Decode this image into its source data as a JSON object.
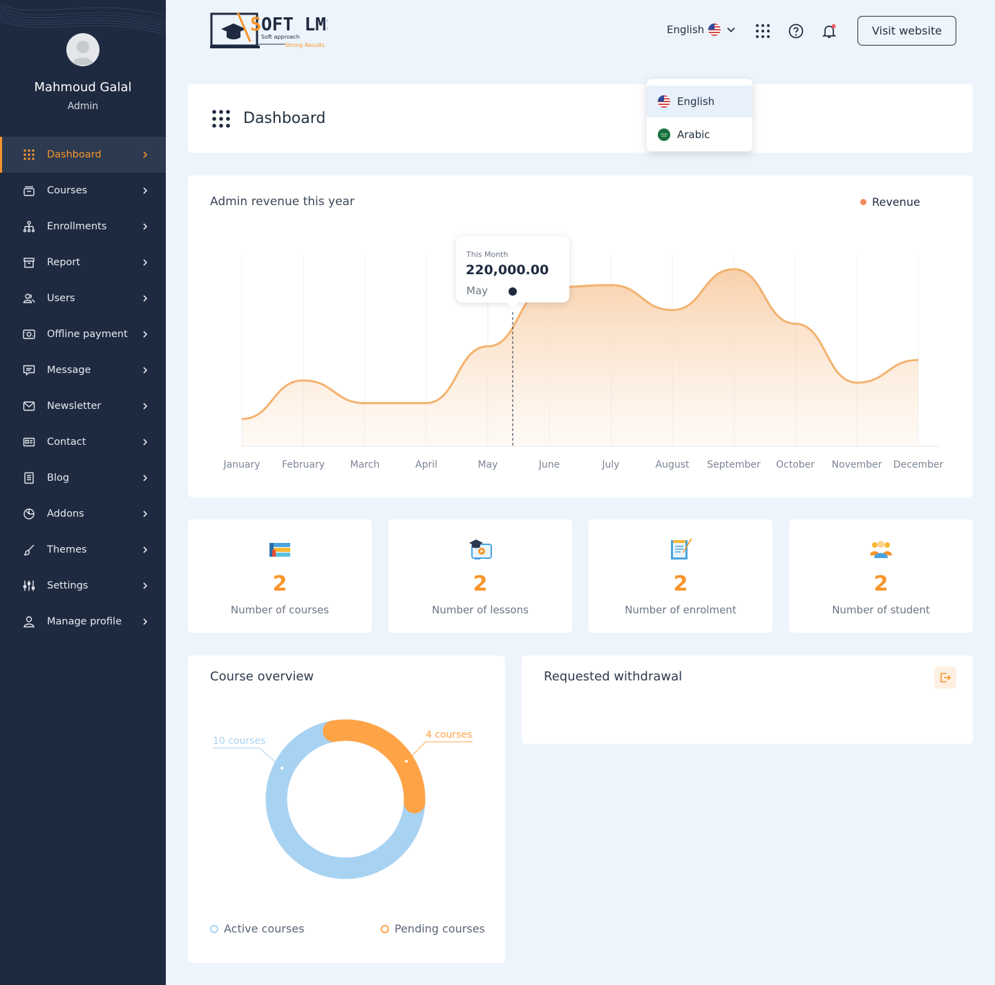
{
  "brand": {
    "name": "SOFT LMS",
    "tagline_1": "Soft approach",
    "tagline_2": "Strong Results"
  },
  "profile": {
    "name": "Mahmoud Galal",
    "role": "Admin"
  },
  "sidebar": {
    "items": [
      {
        "label": "Dashboard",
        "icon": "grid-dots-icon",
        "active": true
      },
      {
        "label": "Courses",
        "icon": "courses-icon"
      },
      {
        "label": "Enrollments",
        "icon": "hierarchy-icon"
      },
      {
        "label": "Report",
        "icon": "archive-icon"
      },
      {
        "label": "Users",
        "icon": "users-icon"
      },
      {
        "label": "Offline payment",
        "icon": "cash-icon"
      },
      {
        "label": "Message",
        "icon": "message-icon"
      },
      {
        "label": "Newsletter",
        "icon": "mail-icon"
      },
      {
        "label": "Contact",
        "icon": "contact-card-icon"
      },
      {
        "label": "Blog",
        "icon": "document-icon"
      },
      {
        "label": "Addons",
        "icon": "addons-icon"
      },
      {
        "label": "Themes",
        "icon": "brush-icon"
      },
      {
        "label": "Settings",
        "icon": "sliders-icon"
      },
      {
        "label": "Manage profile",
        "icon": "user-icon"
      }
    ]
  },
  "header": {
    "language": "English",
    "visit_label": "Visit website",
    "language_menu": [
      "English",
      "Arabic"
    ]
  },
  "page": {
    "title": "Dashboard"
  },
  "revenue": {
    "title": "Admin revenue this year",
    "legend": "Revenue",
    "tooltip": {
      "label": "This Month",
      "value": "220,000.00",
      "month": "May"
    }
  },
  "chart_data": {
    "type": "area",
    "title": "Admin revenue this year",
    "categories": [
      "January",
      "February",
      "March",
      "April",
      "May",
      "June",
      "July",
      "August",
      "September",
      "October",
      "November",
      "December"
    ],
    "series": [
      {
        "name": "Revenue",
        "values": [
          60000,
          145000,
          95000,
          95000,
          220000,
          350000,
          355000,
          300000,
          390000,
          270000,
          140000,
          190000
        ]
      }
    ],
    "legend": "top-right",
    "grid": "vertical"
  },
  "stats": [
    {
      "value": "2",
      "label": "Number of courses",
      "icon": "books-icon"
    },
    {
      "value": "2",
      "label": "Number of lessons",
      "icon": "video-lesson-icon"
    },
    {
      "value": "2",
      "label": "Number of enrolment",
      "icon": "notepad-icon"
    },
    {
      "value": "2",
      "label": "Number of student",
      "icon": "students-icon"
    }
  ],
  "course_overview": {
    "title": "Course overview",
    "active_label": "10 courses",
    "pending_label": "4 courses",
    "legend_active": "Active courses",
    "legend_pending": "Pending courses",
    "active_count": 10,
    "pending_count": 4,
    "active_color": "#a8d2f2",
    "pending_color": "#ffa446"
  },
  "withdrawal": {
    "title": "Requested withdrawal"
  }
}
